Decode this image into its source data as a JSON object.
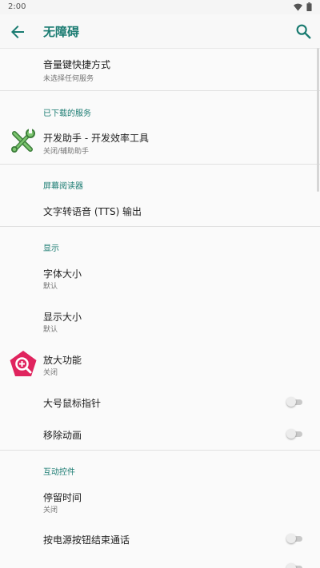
{
  "status_bar": {
    "time": "2:00",
    "icons": [
      "wifi-icon",
      "battery-icon"
    ]
  },
  "app_bar": {
    "title": "无障碍",
    "back_icon": "arrow-back-icon",
    "search_icon": "search-icon"
  },
  "colors": {
    "accent": "#1a7b71",
    "magnifier_icon": "#e0245e",
    "toggle_off": "#c9c9c9"
  },
  "sections": {
    "volume_shortcut": {
      "title": "音量键快捷方式",
      "subtitle": "未选择任何服务"
    },
    "downloaded": {
      "header": "已下载的服务",
      "dev_helper": {
        "title": "开发助手 - 开发效率工具",
        "subtitle": "关闭/辅助助手",
        "icon": "tools-icon"
      }
    },
    "screen_reader": {
      "header": "屏幕阅读器",
      "tts": {
        "title": "文字转语音 (TTS) 输出"
      }
    },
    "display": {
      "header": "显示",
      "font_size": {
        "title": "字体大小",
        "subtitle": "默认"
      },
      "display_size": {
        "title": "显示大小",
        "subtitle": "默认"
      },
      "magnification": {
        "title": "放大功能",
        "subtitle": "关闭",
        "icon": "magnifier-icon"
      },
      "large_pointer": {
        "title": "大号鼠标指针",
        "enabled": false
      },
      "remove_animations": {
        "title": "移除动画",
        "enabled": false
      }
    },
    "interaction": {
      "header": "互动控件",
      "dwell": {
        "title": "停留时间",
        "subtitle": "关闭"
      },
      "power_ends_call": {
        "title": "按电源按钮结束通话",
        "enabled": false
      },
      "auto_rotate": {
        "enabled": false
      }
    }
  }
}
